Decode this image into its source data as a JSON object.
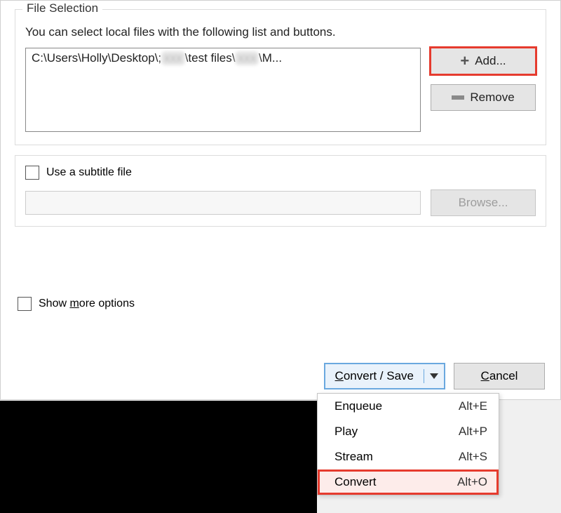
{
  "fileSelection": {
    "title": "File Selection",
    "helpText": "You can select local files with the following list and buttons.",
    "filePathPrefix": "C:\\Users\\Holly\\Desktop\\;",
    "filePathMid": "\\test files\\",
    "filePathSuffix": "\\M...",
    "addLabel": "Add...",
    "removeLabel": "Remove"
  },
  "subtitle": {
    "label": "Use a subtitle file",
    "browseLabel": "Browse..."
  },
  "options": {
    "prefix": "Show ",
    "underlined": "m",
    "suffix": "ore options"
  },
  "footer": {
    "convertPrefix": "",
    "convertUnder": "C",
    "convertSuffix": "onvert / Save",
    "cancelUnder": "C",
    "cancelSuffix": "ancel"
  },
  "menu": {
    "items": [
      {
        "label": "Enqueue",
        "shortcut": "Alt+E",
        "highlight": false
      },
      {
        "label": "Play",
        "shortcut": "Alt+P",
        "highlight": false
      },
      {
        "label": "Stream",
        "shortcut": "Alt+S",
        "highlight": false
      },
      {
        "label": "Convert",
        "shortcut": "Alt+O",
        "highlight": true
      }
    ]
  }
}
